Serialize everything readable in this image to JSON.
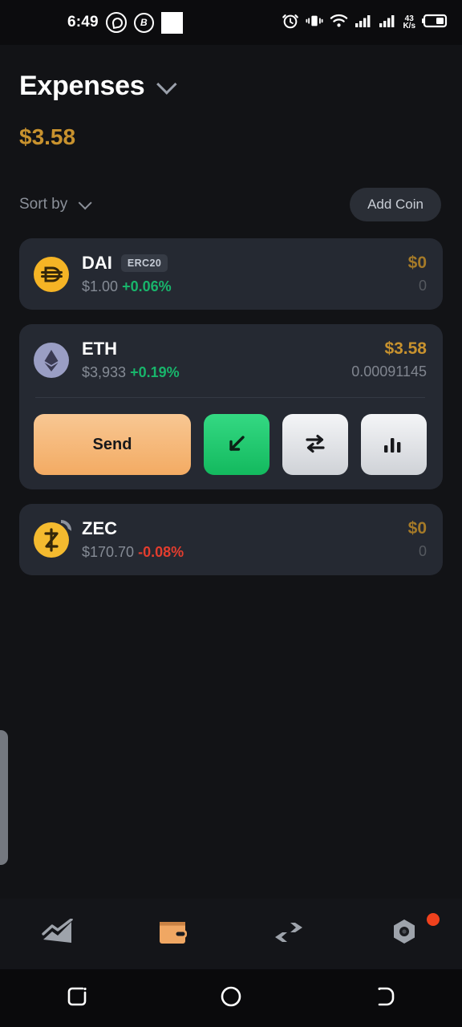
{
  "statusbar": {
    "time": "6:49",
    "icons": [
      "whatsapp-icon",
      "circled-b-icon",
      "white-square-icon"
    ],
    "right_icons": [
      "alarm-icon",
      "vibrate-icon",
      "wifi-icon",
      "signal-1-icon",
      "signal-2-icon",
      "battery-icon"
    ],
    "net_speed_value": "43",
    "net_speed_unit": "K/s"
  },
  "header": {
    "title": "Expenses",
    "dropdown_icon": "chevron-down-icon",
    "balance": "$3.58"
  },
  "sortbar": {
    "sort_label": "Sort by",
    "sort_icon": "chevron-down-icon",
    "add_coin_label": "Add Coin"
  },
  "coins": [
    {
      "symbol": "DAI",
      "badge": "ERC20",
      "price": "$1.00",
      "change": "+0.06%",
      "change_dir": "up",
      "fiat": "$0",
      "amount": "0",
      "zero": true,
      "icon": "dai-coin-icon",
      "expanded": false
    },
    {
      "symbol": "ETH",
      "badge": "",
      "price": "$3,933",
      "change": "+0.19%",
      "change_dir": "up",
      "fiat": "$3.58",
      "amount": "0.00091145",
      "zero": false,
      "icon": "eth-coin-icon",
      "expanded": true
    },
    {
      "symbol": "ZEC",
      "badge": "",
      "price": "$170.70",
      "change": "-0.08%",
      "change_dir": "down",
      "fiat": "$0",
      "amount": "0",
      "zero": true,
      "icon": "zec-coin-icon",
      "expanded": false
    }
  ],
  "actions": {
    "send_label": "Send",
    "receive_icon": "arrow-down-left-icon",
    "swap_icon": "swap-arrows-icon",
    "chart_icon": "bar-chart-icon"
  },
  "bottomnav": {
    "items": [
      {
        "name": "market-chart-icon",
        "active": false
      },
      {
        "name": "wallet-icon",
        "active": true
      },
      {
        "name": "exchange-arrows-icon",
        "active": false
      },
      {
        "name": "settings-nut-icon",
        "active": false,
        "badge_dot": true
      }
    ]
  },
  "androidnav": {
    "items": [
      "recents-icon",
      "home-icon",
      "back-icon"
    ]
  },
  "colors": {
    "accent_gold": "#c8922e",
    "send_orange": "#f3ab63",
    "receive_green": "#18b56b",
    "negative_red": "#e33d2e",
    "card_bg": "#252932",
    "page_bg": "#121316",
    "notification_red": "#f0411d"
  }
}
